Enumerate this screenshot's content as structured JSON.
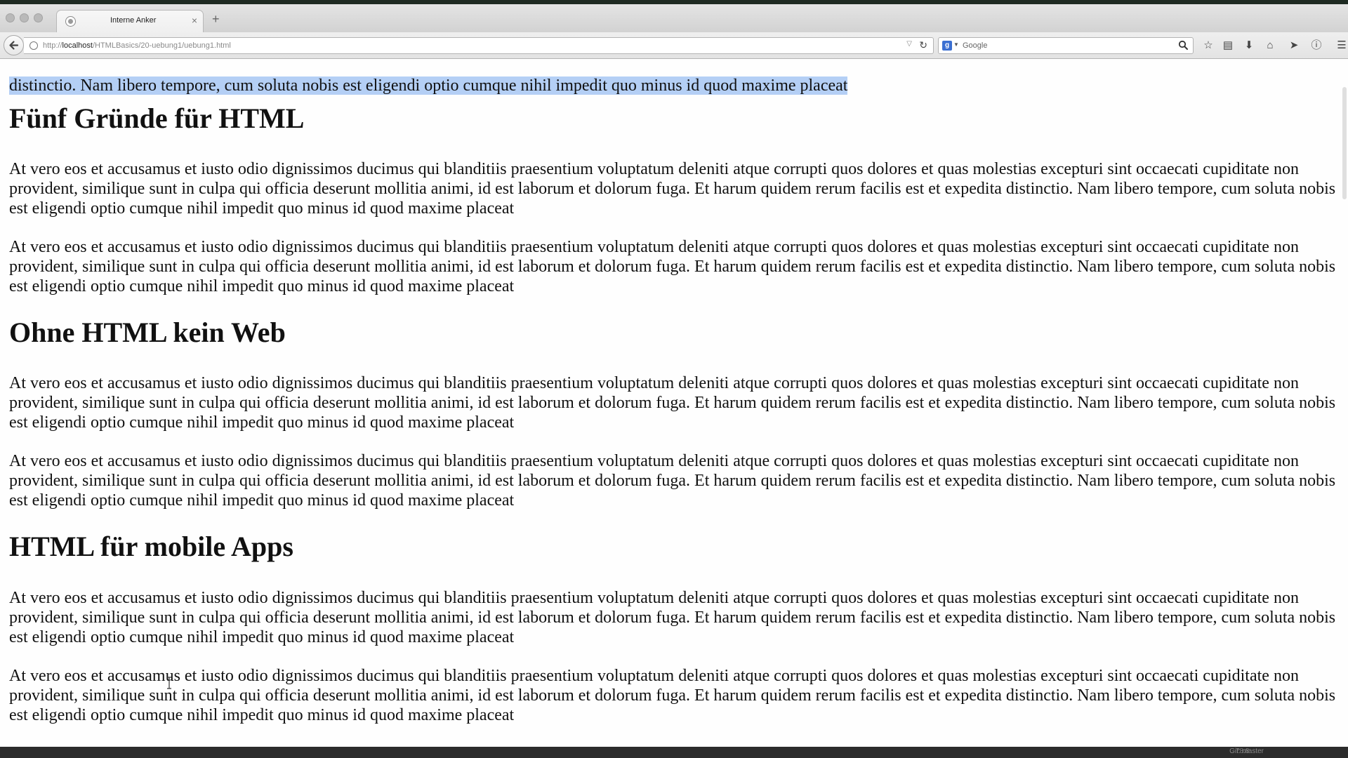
{
  "browser": {
    "tab_title": "Interne Anker",
    "tab_close": "×",
    "new_tab": "+",
    "url_prefix": "http://",
    "url_host": "localhost",
    "url_path": "/HTMLBasics/20-uebung1/uebung1.html",
    "search_engine_icon": "g",
    "search_placeholder": "Google"
  },
  "icons": {
    "back": "arrow-left-icon",
    "reload": "reload-icon",
    "bookmark": "star-icon",
    "reading_list": "clipboard-icon",
    "download": "download-icon",
    "home": "home-icon",
    "send": "paper-plane-icon",
    "info": "info-icon",
    "menu": "hamburger-menu-icon"
  },
  "page": {
    "selected_text": "distinctio. Nam libero tempore, cum soluta nobis est eligendi optio cumque nihil impedit quo minus id quod maxime placeat",
    "sections": [
      {
        "heading": "Fünf Gründe für HTML",
        "paragraphs": [
          "At vero eos et accusamus et iusto odio dignissimos ducimus qui blanditiis praesentium voluptatum deleniti atque corrupti quos dolores et quas molestias excepturi sint occaecati cupiditate non provident, similique sunt in culpa qui officia deserunt mollitia animi, id est laborum et dolorum fuga. Et harum quidem rerum facilis est et expedita distinctio. Nam libero tempore, cum soluta nobis est eligendi optio cumque nihil impedit quo minus id quod maxime placeat",
          "At vero eos et accusamus et iusto odio dignissimos ducimus qui blanditiis praesentium voluptatum deleniti atque corrupti quos dolores et quas molestias excepturi sint occaecati cupiditate non provident, similique sunt in culpa qui officia deserunt mollitia animi, id est laborum et dolorum fuga. Et harum quidem rerum facilis est et expedita distinctio. Nam libero tempore, cum soluta nobis est eligendi optio cumque nihil impedit quo minus id quod maxime placeat"
        ]
      },
      {
        "heading": "Ohne HTML kein Web",
        "paragraphs": [
          "At vero eos et accusamus et iusto odio dignissimos ducimus qui blanditiis praesentium voluptatum deleniti atque corrupti quos dolores et quas molestias excepturi sint occaecati cupiditate non provident, similique sunt in culpa qui officia deserunt mollitia animi, id est laborum et dolorum fuga. Et harum quidem rerum facilis est et expedita distinctio. Nam libero tempore, cum soluta nobis est eligendi optio cumque nihil impedit quo minus id quod maxime placeat",
          "At vero eos et accusamus et iusto odio dignissimos ducimus qui blanditiis praesentium voluptatum deleniti atque corrupti quos dolores et quas molestias excepturi sint occaecati cupiditate non provident, similique sunt in culpa qui officia deserunt mollitia animi, id est laborum et dolorum fuga. Et harum quidem rerum facilis est et expedita distinctio. Nam libero tempore, cum soluta nobis est eligendi optio cumque nihil impedit quo minus id quod maxime placeat"
        ]
      },
      {
        "heading": "HTML für mobile Apps",
        "paragraphs": [
          "At vero eos et accusamus et iusto odio dignissimos ducimus qui blanditiis praesentium voluptatum deleniti atque corrupti quos dolores et quas molestias excepturi sint occaecati cupiditate non provident, similique sunt in culpa qui officia deserunt mollitia animi, id est laborum et dolorum fuga. Et harum quidem rerum facilis est et expedita distinctio. Nam libero tempore, cum soluta nobis est eligendi optio cumque nihil impedit quo minus id quod maxime placeat",
          "At vero eos et accusamus et iusto odio dignissimos ducimus qui blanditiis praesentium voluptatum deleniti atque corrupti quos dolores et quas molestias excepturi sint occaecati cupiditate non provident, similique sunt in culpa qui officia deserunt mollitia animi, id est laborum et dolorum fuga. Et harum quidem rerum facilis est et expedita distinctio. Nam libero tempore, cum soluta nobis est eligendi optio cumque nihil impedit quo minus id quod maxime placeat"
        ]
      }
    ]
  },
  "status": {
    "git": "Git: master",
    "position": "78:8"
  },
  "colors": {
    "selection": "#b4cff5",
    "page_background": "#fefefe",
    "chrome": "#e4e4e4"
  }
}
